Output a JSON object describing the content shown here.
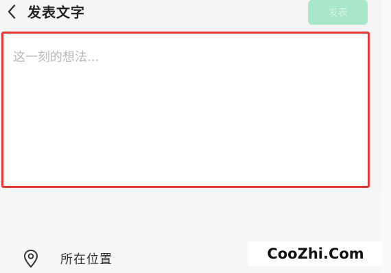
{
  "header": {
    "back_icon": "chevron-left-icon",
    "title": "发表文字",
    "send_button_label": "发表",
    "send_button_color": "#a8e6c8"
  },
  "composer": {
    "value": "",
    "placeholder": "这一刻的想法...",
    "highlight_border_color": "#e53935"
  },
  "location": {
    "icon": "location-pin-icon",
    "label": "所在位置"
  },
  "watermark": {
    "text": "CooZhi.Com"
  }
}
